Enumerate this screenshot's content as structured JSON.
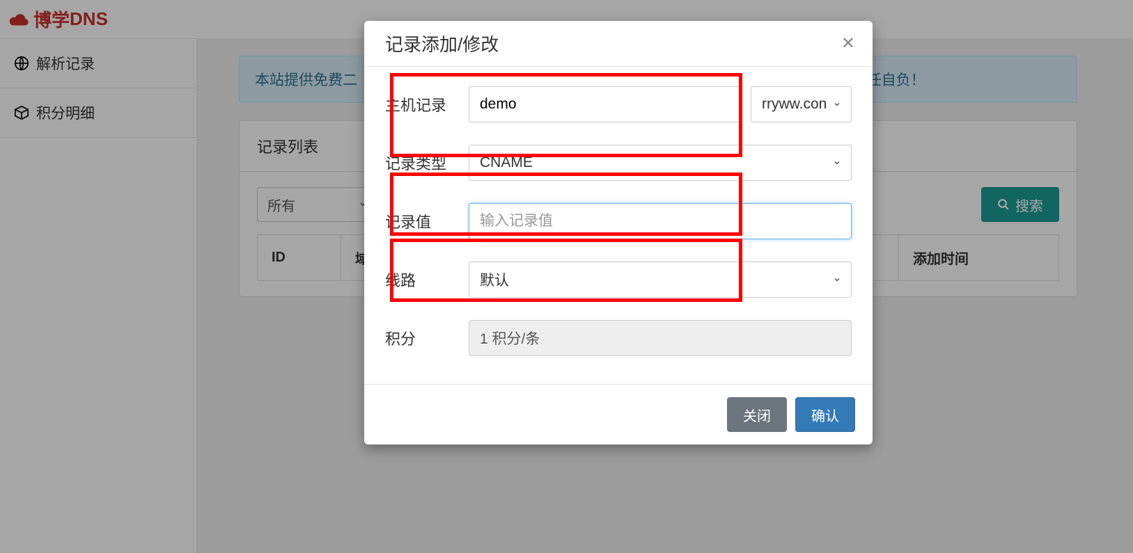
{
  "brand": {
    "text1": "博学",
    "text2": "DNS"
  },
  "sidebar": {
    "items": [
      {
        "label": "解析记录"
      },
      {
        "label": "积分明细"
      }
    ]
  },
  "alert": {
    "prefix": "本站提供免费二",
    "suffix": "任自负！"
  },
  "panel": {
    "title": "记录列表"
  },
  "toolbar": {
    "filter_all": "所有",
    "search_btn": "搜索"
  },
  "table": {
    "headers": [
      "ID",
      "域",
      "添加时间"
    ]
  },
  "modal": {
    "title": "记录添加/修改",
    "labels": {
      "host": "主机记录",
      "type": "记录类型",
      "value": "记录值",
      "line": "线路",
      "points": "积分"
    },
    "host_value": "demo",
    "domain_select": "rryww.con",
    "type_value": "CNAME",
    "value_placeholder": "输入记录值",
    "line_value": "默认",
    "points_value": "1 积分/条",
    "buttons": {
      "close": "关闭",
      "confirm": "确认"
    }
  }
}
